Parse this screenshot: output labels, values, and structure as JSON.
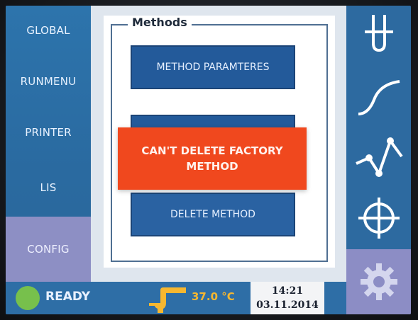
{
  "left_nav": {
    "items": [
      {
        "label": "GLOBAL"
      },
      {
        "label": "RUNMENU"
      },
      {
        "label": "PRINTER"
      },
      {
        "label": "LIS"
      },
      {
        "label": "CONFIG",
        "active": true
      }
    ]
  },
  "methods_panel": {
    "title": "Methods",
    "buttons": [
      {
        "label": "METHOD PARAMTERES"
      },
      {
        "label": ""
      },
      {
        "label": "DELETE METHOD"
      }
    ],
    "alert_line1": "CAN'T DELETE FACTORY",
    "alert_line2": "METHOD"
  },
  "right_bar": {
    "icons": [
      "test-tube-icon",
      "curve-icon",
      "graph-icon",
      "crosshair-icon",
      "gear-icon"
    ]
  },
  "status_bar": {
    "status": "READY",
    "temperature": "37.0 °C",
    "time": "14:21",
    "date": "03.11.2014"
  },
  "colors": {
    "primary_blue": "#2d6ea6",
    "button_blue": "#235a9a",
    "active_tab": "#8d8fc4",
    "alert_orange": "#f0481e",
    "ready_green": "#77c04c",
    "temp_orange": "#f6b730"
  }
}
